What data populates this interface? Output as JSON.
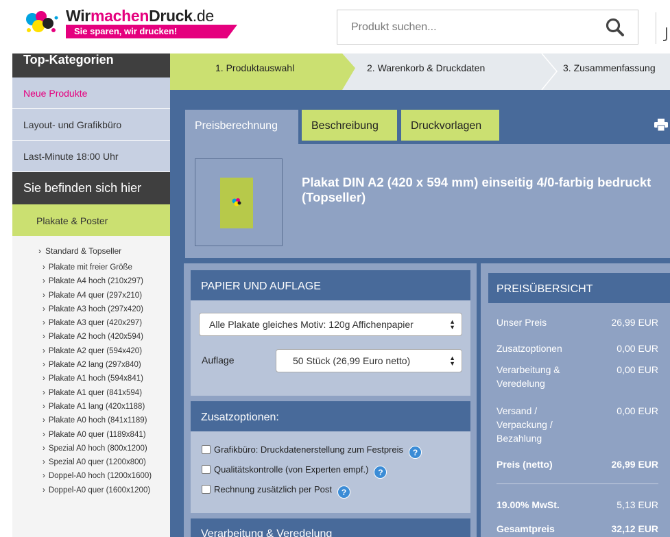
{
  "brand": {
    "name_part1": "Wir",
    "name_part2": "machen",
    "name_part3": "Druck",
    "name_part4": ".de",
    "slogan": "Sie sparen, wir drucken!"
  },
  "search": {
    "placeholder": "Produkt suchen...",
    "icon": "search-icon"
  },
  "sidebar": {
    "top_heading": "Top-Kategorien",
    "items": [
      "Neue Produkte",
      "Layout- und Grafikbüro",
      "Last-Minute 18:00 Uhr"
    ],
    "location_heading": "Sie befinden sich hier",
    "category": "Plakate & Poster",
    "subcategory": "Standard & Topseller",
    "links": [
      "Plakate mit freier Größe",
      "Plakate A4 hoch (210x297)",
      "Plakate A4 quer (297x210)",
      "Plakate A3 hoch (297x420)",
      "Plakate A3 quer (420x297)",
      "Plakate A2 hoch (420x594)",
      "Plakate A2 quer (594x420)",
      "Plakate A2 lang (297x840)",
      "Plakate A1 hoch (594x841)",
      "Plakate A1 quer (841x594)",
      "Plakate A1 lang (420x1188)",
      "Plakate A0 hoch (841x1189)",
      "Plakate A0 quer (1189x841)",
      "Spezial A0 hoch (800x1200)",
      "Spezial A0 quer (1200x800)",
      "Doppel-A0 hoch (1200x1600)",
      "Doppel-A0 quer (1600x1200)"
    ]
  },
  "steps": [
    "1. Produktauswahl",
    "2. Warenkorb & Druckdaten",
    "3. Zusammenfassung"
  ],
  "tabs": [
    "Preisberechnung",
    "Beschreibung",
    "Druckvorlagen"
  ],
  "product": {
    "title": "Plakat DIN A2 (420 x 594 mm) einseitig 4/0-farbig bedruckt (Topseller)"
  },
  "paper": {
    "heading": "PAPIER UND AUFLAGE",
    "paper_select": "Alle Plakate gleiches Motiv: 120g Affichenpapier",
    "auflage_label": "Auflage",
    "auflage_select": "50 Stück (26,99 Euro netto)"
  },
  "options": {
    "heading": "Zusatzoptionen:",
    "items": [
      "Grafikbüro: Druckdatenerstellung zum Festpreis",
      "Qualitätskontrolle (von Experten empf.)",
      "Rechnung zusätzlich per Post"
    ],
    "help_symbol": "?"
  },
  "finishing": {
    "heading": "Verarbeitung & Veredelung"
  },
  "price": {
    "heading": "PREISÜBERSICHT",
    "rows": [
      {
        "label": "Unser Preis",
        "value": "26,99 EUR"
      },
      {
        "label": "Zusatzoptionen",
        "value": "0,00 EUR"
      },
      {
        "label": "Verarbeitung & Veredelung",
        "value": "0,00 EUR"
      },
      {
        "label": "Versand / Verpackung / Bezahlung",
        "value": "0,00 EUR"
      },
      {
        "label": "Preis (netto)",
        "value": "26,99 EUR"
      },
      {
        "label": "19.00% MwSt.",
        "value": "5,13 EUR"
      },
      {
        "label": "Gesamtpreis",
        "value": "32,12 EUR"
      }
    ]
  },
  "colors": {
    "brand_pink": "#e5007e",
    "accent_green": "#cbe071",
    "panel_blue": "#486a9a",
    "light_blue": "#8fa2c3"
  }
}
